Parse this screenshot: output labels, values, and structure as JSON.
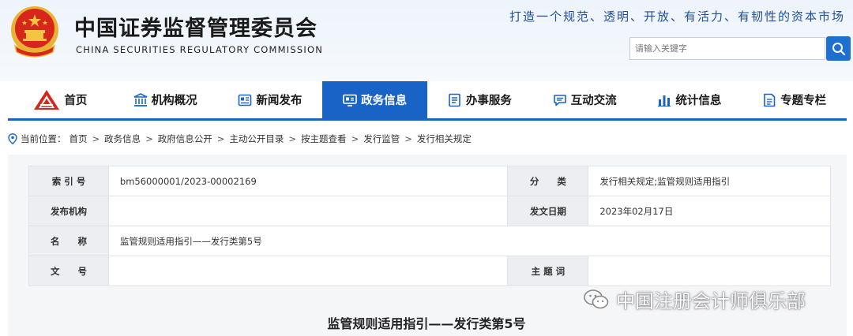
{
  "header": {
    "title_cn": "中国证券监督管理委员会",
    "title_en": "CHINA SECURITIES REGULATORY COMMISSION",
    "slogan": "打造一个规范、透明、开放、有活力、有韧性的资本市场",
    "emblem_icon": "national-emblem-icon",
    "search": {
      "placeholder": "请输入关键字",
      "icon": "search-icon"
    }
  },
  "nav": [
    {
      "label": "首页",
      "icon": "home-logo-icon",
      "active": false
    },
    {
      "label": "机构概况",
      "icon": "building-icon",
      "active": false
    },
    {
      "label": "新闻发布",
      "icon": "newspaper-icon",
      "active": false
    },
    {
      "label": "政务信息",
      "icon": "monitor-icon",
      "active": true
    },
    {
      "label": "办事服务",
      "icon": "list-icon",
      "active": false
    },
    {
      "label": "互动交流",
      "icon": "chat-icon",
      "active": false
    },
    {
      "label": "统计信息",
      "icon": "bar-chart-icon",
      "active": false
    },
    {
      "label": "专题专栏",
      "icon": "document-icon",
      "active": false
    }
  ],
  "breadcrumb": {
    "prefix": "当前位置：",
    "items": [
      "首页",
      "政务信息",
      "政府信息公开",
      "主动公开目录",
      "按主题查看",
      "发行监管",
      "发行相关规定"
    ],
    "separator": ">"
  },
  "info": {
    "index_label": "索 引 号",
    "index_value": "bm56000001/2023-00002169",
    "category_label": "分　　类",
    "category_value": "发行相关规定;监管规则适用指引",
    "issuer_label": "发布机构",
    "issuer_value": "",
    "date_label": "发文日期",
    "date_value": "2023年02月17日",
    "name_label": "名　　称",
    "name_value": "监管规则适用指引——发行类第5号",
    "docno_label": "文　　号",
    "docno_value": "",
    "subject_label": "主 题 词",
    "subject_value": ""
  },
  "article": {
    "title": "监管规则适用指引——发行类第5号"
  },
  "watermark": {
    "text": "中国注册会计师俱乐部",
    "icon": "wechat-icon"
  },
  "colors": {
    "brand_blue": "#1a63c6",
    "emblem_red": "#d7261b",
    "gold": "#f4c542"
  }
}
